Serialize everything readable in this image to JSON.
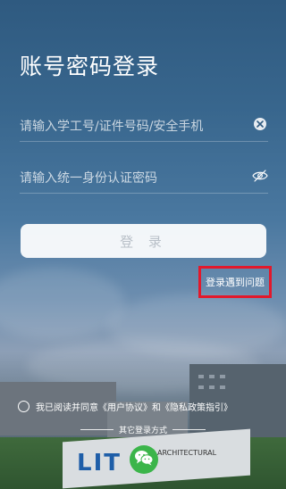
{
  "page": {
    "title": "账号密码登录"
  },
  "account": {
    "placeholder": "请输入学工号/证件号码/安全手机",
    "value": ""
  },
  "password": {
    "placeholder": "请输入统一身份认证密码",
    "value": ""
  },
  "login_button": {
    "label": "登 录"
  },
  "trouble_link": {
    "label": "登录遇到问题"
  },
  "agreement": {
    "prefix": "我已阅读并同意",
    "user_agreement": "《用户协议》",
    "conjunction": "和",
    "privacy_policy": "《隐私政策指引》",
    "checked": false
  },
  "other_login": {
    "label": "其它登录方式",
    "methods": [
      {
        "icon": "wechat-icon"
      }
    ]
  },
  "background": {
    "sign_letters": "LIT",
    "sign_subtitle": "ARCHITECTURAL"
  },
  "colors": {
    "highlight_border": "#e3182b",
    "wechat_green": "#3bb54a",
    "button_text_disabled": "#b9c0c8"
  }
}
